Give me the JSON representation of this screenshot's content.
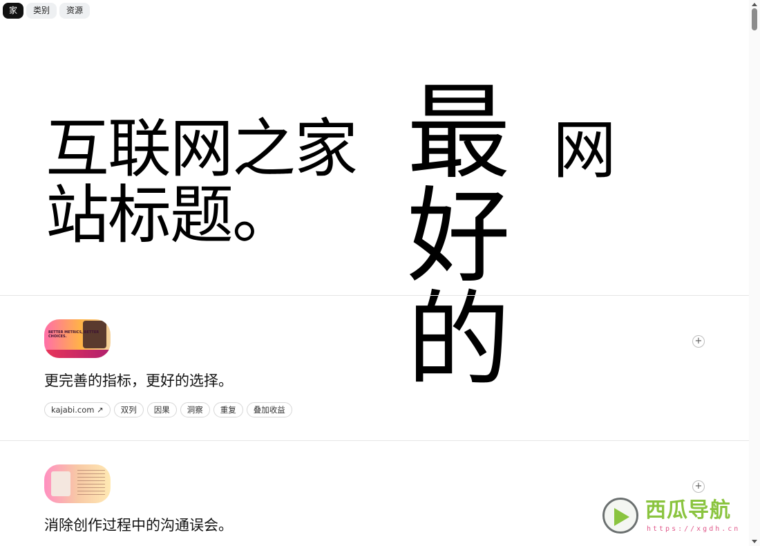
{
  "nav": {
    "items": [
      {
        "label": "家",
        "active": true
      },
      {
        "label": "类别",
        "active": false
      },
      {
        "label": "资源",
        "active": false
      }
    ]
  },
  "hero": {
    "title_line1": "互联网之家",
    "title_line2": "站标题。",
    "big_chars": [
      "最",
      "好",
      "的"
    ],
    "right_char": "网"
  },
  "rows": [
    {
      "thumb_text": "BETTER METRICS, BETTER CHOICES.",
      "title": "更完善的指标，更好的选择。",
      "tags": [
        "kajabi.com ↗",
        "双列",
        "因果",
        "洞察",
        "重复",
        "叠加收益"
      ]
    },
    {
      "title": "消除创作过程中的沟通误会。"
    }
  ],
  "watermark": {
    "name": "西瓜导航",
    "url": "https://xgdh.cn"
  },
  "colors": {
    "accent_green": "#8ac43f",
    "url_pink": "#e0588a",
    "active_nav": "#111111"
  }
}
